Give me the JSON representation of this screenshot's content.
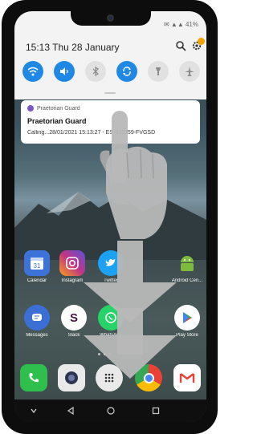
{
  "status_bar": {
    "indicators": "✉ ▲▲ 41%"
  },
  "shade": {
    "datetime": "15:13  Thu 28 January",
    "quick_settings": [
      {
        "name": "wifi",
        "state": "on"
      },
      {
        "name": "sound",
        "state": "on"
      },
      {
        "name": "bluetooth",
        "state": "off"
      },
      {
        "name": "auto-rotate",
        "state": "on"
      },
      {
        "name": "flashlight",
        "state": "off"
      },
      {
        "name": "airplane-mode",
        "state": "off"
      }
    ]
  },
  "notification": {
    "app": "Praetorian Guard",
    "title": "Praetorian Guard",
    "text": "Calling...28/01/2021 15:13:27 - ES-012359-FVGSD"
  },
  "apps_row1": [
    {
      "label": "Calendar",
      "icon": "calendar-icon",
      "color": "#3d73d9"
    },
    {
      "label": "Instagram",
      "icon": "instagram-icon",
      "color": "#c13584"
    },
    {
      "label": "Twitter",
      "icon": "twitter-icon",
      "color": "#1da1f2"
    },
    {
      "label": "Android Cen...",
      "icon": "android-icon",
      "color": "#7dbb3f"
    }
  ],
  "apps_row2": [
    {
      "label": "Messages",
      "icon": "messages-icon",
      "color": "#3b6fd6"
    },
    {
      "label": "Slack",
      "icon": "slack-icon",
      "color": "#ffffff"
    },
    {
      "label": "WhatsApp",
      "icon": "whatsapp-icon",
      "color": "#25d366"
    },
    {
      "label": "Play Store",
      "icon": "play-store-icon",
      "color": "#ffffff"
    }
  ],
  "dock": [
    {
      "label": "Phone",
      "icon": "phone-icon",
      "color": "#2fbf4d"
    },
    {
      "label": "Camera",
      "icon": "camera-icon",
      "color": "#e9e9e9"
    },
    {
      "label": "App drawer",
      "icon": "app-drawer-icon",
      "color": "#e9e9e9"
    },
    {
      "label": "Chrome",
      "icon": "chrome-icon",
      "color": "#ffffff"
    },
    {
      "label": "Gmail",
      "icon": "gmail-icon",
      "color": "#ffffff"
    }
  ],
  "colors": {
    "accent": "#1f88e5",
    "shade_bg": "#f3f3f3",
    "gesture_overlay": "#b8b8b8"
  }
}
